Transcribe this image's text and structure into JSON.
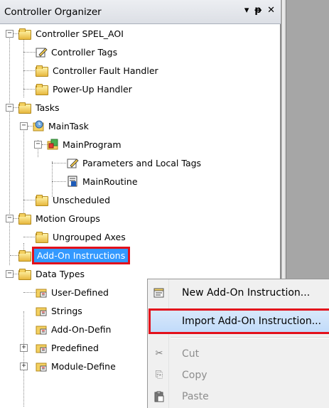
{
  "panel": {
    "title": "Controller Organizer",
    "pin_glyph": "▾",
    "dock_glyph": "ᵽ",
    "close_glyph": "✕"
  },
  "tree": {
    "controller": "Controller SPEL_AOI",
    "controller_tags": "Controller Tags",
    "fault_handler": "Controller Fault Handler",
    "powerup_handler": "Power-Up Handler",
    "tasks": "Tasks",
    "main_task": "MainTask",
    "main_program": "MainProgram",
    "params_local_tags": "Parameters and Local Tags",
    "main_routine": "MainRoutine",
    "unscheduled": "Unscheduled",
    "motion_groups": "Motion Groups",
    "ungrouped_axes": "Ungrouped Axes",
    "add_on_instructions": "Add-On Instructions",
    "data_types": "Data Types",
    "user_defined": "User-Defined",
    "strings": "Strings",
    "add_on_defined": "Add-On-Defin",
    "predefined": "Predefined",
    "module_defined": "Module-Define",
    "collapse_glyph": "−",
    "expand_glyph": "+"
  },
  "context_menu": {
    "new_aoi": "New Add-On Instruction...",
    "import_aoi": "Import Add-On Instruction...",
    "cut": "Cut",
    "copy": "Copy",
    "paste": "Paste",
    "cut_icon": "✂",
    "copy_icon": "⎘"
  },
  "colors": {
    "selection": "#3399ff",
    "highlight_outline": "#e3101b",
    "menu_hover": "#c1dbfa"
  }
}
